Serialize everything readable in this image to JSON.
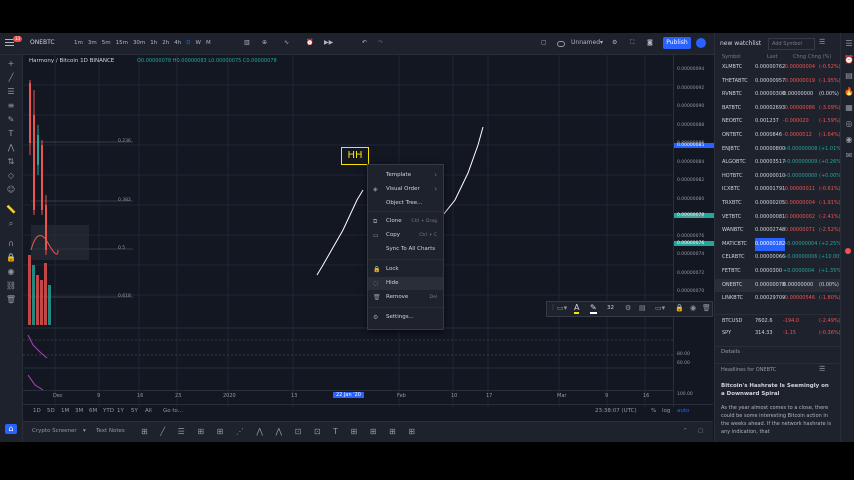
{
  "symbol": "ONEBTC",
  "notification_count": "13",
  "toolbar": {
    "intervals": [
      "1m",
      "3m",
      "5m",
      "15m",
      "30m",
      "1h",
      "2h",
      "4h",
      "D",
      "W",
      "M"
    ],
    "layout_name": "Unnamed",
    "publish": "Publish"
  },
  "legend": {
    "title": "Harmony / Bitcoin 1D BINANCE",
    "ohlc": "O0.00000078 H0.00000083 L0.00000075 C0.00000078",
    "fib_levels": [
      "0.236",
      "0.382",
      "0.5",
      "0.618"
    ]
  },
  "drawing_label": "HH",
  "context_menu": {
    "items": [
      {
        "label": "Template",
        "arrow": "›"
      },
      {
        "label": "Visual Order",
        "arrow": "›"
      },
      {
        "label": "Object Tree..."
      },
      {
        "label": "Clone",
        "shortcut": "Ctrl + Drag"
      },
      {
        "label": "Copy",
        "shortcut": "Ctrl + C"
      },
      {
        "label": "Sync To All Charts"
      },
      {
        "label": "Lock"
      },
      {
        "label": "Hide"
      },
      {
        "label": "Remove",
        "shortcut": "Del"
      },
      {
        "label": "Settings..."
      }
    ]
  },
  "draw_toolbar": {
    "size": "32"
  },
  "price_scale": [
    "0.00000094",
    "0.00000092",
    "0.00000090",
    "0.00000088",
    "0.00000086",
    "0.00000084",
    "0.00000082",
    "0.00000080",
    "0.00000078",
    "0.00000076",
    "0.00000074",
    "0.00000072",
    "0.00000070"
  ],
  "price_tags": [
    "0.00000085",
    "0.00000078",
    "0.00000076"
  ],
  "osc_scale": [
    "80.00",
    "60.00",
    "100.00"
  ],
  "time_axis": [
    "Dec",
    "9",
    "16",
    "23",
    "2020",
    "13",
    "22 Jan '20",
    "Feb",
    "10",
    "17",
    "Mar",
    "9",
    "16"
  ],
  "range_bar": {
    "ranges": [
      "1D",
      "5D",
      "1M",
      "3M",
      "6M",
      "YTD",
      "1Y",
      "5Y",
      "All"
    ],
    "goto": "Go to...",
    "clock": "23:38:07 (UTC)",
    "pct": "%",
    "log": "log",
    "auto": "auto"
  },
  "bottom_bar": {
    "screener": "Crypto Screener",
    "text_notes": "Text Notes"
  },
  "watchlist": {
    "title": "new watchlist",
    "add_symbol": "Add Symbol",
    "columns": [
      "Symbol",
      "Last",
      "Chng",
      "Chng (%)"
    ],
    "rows": [
      {
        "symbol": "XLMBTC",
        "last": "0.00000762",
        "chng": "-0.00000004",
        "pct": "(-0.52%)",
        "color": "#ef5350"
      },
      {
        "symbol": "THETABTC",
        "last": "0.00000957",
        "chng": "-0.00000019",
        "pct": "(-1.95%)",
        "color": "#ef5350"
      },
      {
        "symbol": "RVNBTC",
        "last": "0.00000300",
        "chng": "0.00000000",
        "pct": "(0.00%)",
        "color": "#d1d4dc"
      },
      {
        "symbol": "BATBTC",
        "last": "0.00002693",
        "chng": "-0.00000086",
        "pct": "(-3.09%)",
        "color": "#ef5350"
      },
      {
        "symbol": "NEOBTC",
        "last": "0.001237",
        "chng": "-0.000020",
        "pct": "(-1.59%)",
        "color": "#ef5350"
      },
      {
        "symbol": "ONTBTC",
        "last": "0.0000846",
        "chng": "-0.0000012",
        "pct": "(-1.64%)",
        "color": "#ef5350"
      },
      {
        "symbol": "ENJBTC",
        "last": "0.00000800",
        "chng": "+0.00000008",
        "pct": "(+1.01%)",
        "color": "#26a69a"
      },
      {
        "symbol": "ALGOBTC",
        "last": "0.00003517",
        "chng": "+0.00000009",
        "pct": "(+0.26%)",
        "color": "#26a69a"
      },
      {
        "symbol": "HOTBTC",
        "last": "0.00000010",
        "chng": "+0.00000000",
        "pct": "(+0.00%)",
        "color": "#26a69a"
      },
      {
        "symbol": "ICXBTC",
        "last": "0.00001791",
        "chng": "-0.00000011",
        "pct": "(-0.61%)",
        "color": "#ef5350"
      },
      {
        "symbol": "TRXBTC",
        "last": "0.00000205",
        "chng": "-0.00000004",
        "pct": "(-1.91%)",
        "color": "#ef5350"
      },
      {
        "symbol": "VETBTC",
        "last": "0.00000081",
        "chng": "-0.00000002",
        "pct": "(-2.41%)",
        "color": "#ef5350"
      },
      {
        "symbol": "WANBTC",
        "last": "0.00002748",
        "chng": "-0.00000071",
        "pct": "(-2.52%)",
        "color": "#ef5350"
      },
      {
        "symbol": "MATICBTC",
        "last": "0.00000182",
        "chng": "+0.00000004",
        "pct": "(+2.25%)",
        "color": "#26a69a"
      },
      {
        "symbol": "CELRBTC",
        "last": "0.00000066",
        "chng": "+0.00000006",
        "pct": "(+10.00%)",
        "color": "#26a69a"
      },
      {
        "symbol": "FETBTC",
        "last": "0.0000300",
        "chng": "+0.0000004",
        "pct": "(+1.35%)",
        "color": "#26a69a"
      },
      {
        "symbol": "ONEBTC",
        "last": "0.00000078",
        "chng": "0.00000000",
        "pct": "(0.00%)",
        "color": "#d1d4dc"
      },
      {
        "symbol": "LINKBTC",
        "last": "0.00029709",
        "chng": "-0.00000546",
        "pct": "(-1.80%)",
        "color": "#ef5350"
      },
      {
        "symbol": "BTCUSD",
        "last": "7602.6",
        "chng": "-194.0",
        "pct": "(-2.49%)",
        "color": "#ef5350"
      },
      {
        "symbol": "SPY",
        "last": "314.33",
        "chng": "-1.15",
        "pct": "(-0.36%)",
        "color": "#ef5350"
      }
    ],
    "details": "Details",
    "headlines_title": "Headlines for ONEBTC",
    "headline": "Bitcoin's Hashrate Is Seemingly on a Downward Spiral",
    "article": "As the year almost comes to a close, there could be some interesting Bitcoin action in the weeks ahead. If the network hashrate is any indication, that"
  },
  "colors": {
    "bg": "#131722",
    "panel": "#1e222d",
    "accent": "#2962ff",
    "up": "#26a69a",
    "down": "#ef5350",
    "drawing_label": "#f9e400"
  }
}
